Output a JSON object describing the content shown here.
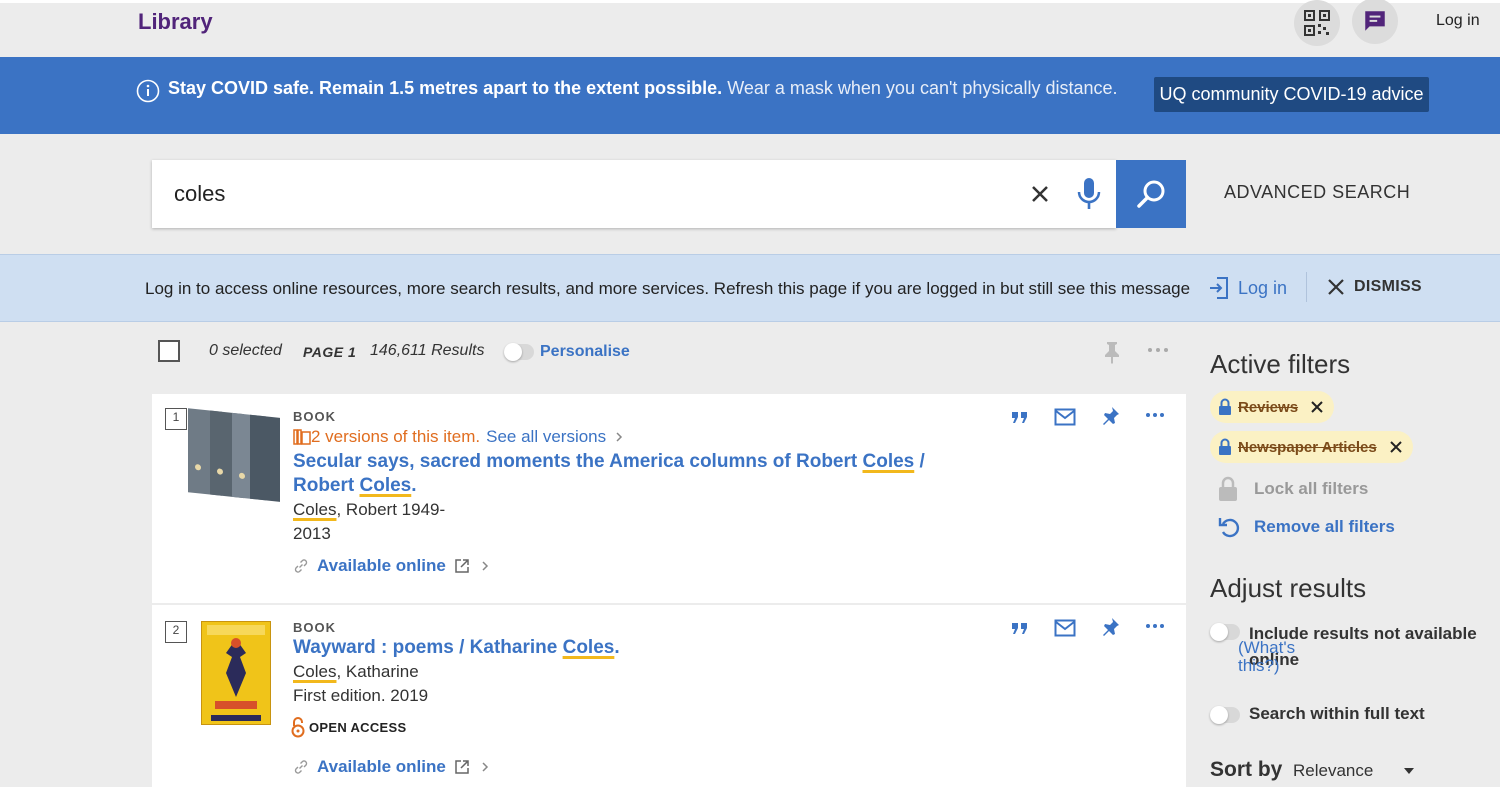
{
  "header": {
    "logo": "Library",
    "login": "Log in"
  },
  "covid_banner": {
    "bold_text": "Stay COVID safe. Remain 1.5 metres apart to the extent possible.",
    "light_text": "Wear a mask when you can't physically distance.",
    "advice_button": "UQ community COVID-19 advice"
  },
  "search": {
    "query": "coles",
    "advanced_label": "ADVANCED SEARCH"
  },
  "login_notice": {
    "message": "Log in to access online resources, more search results, and more services. Refresh this page if you are logged in but still see this message",
    "login_label": "Log in",
    "dismiss_label": "DISMISS"
  },
  "toolbar": {
    "selected": "0 selected",
    "page": "PAGE 1",
    "results": "146,611 Results",
    "personalise": "Personalise"
  },
  "results": [
    {
      "number": "1",
      "type": "BOOK",
      "versions_text": "2 versions of this item.",
      "see_all": "See all versions",
      "title_part1": "Secular says, sacred moments the America columns of Robert ",
      "title_hl1": "Coles",
      "title_part2": " / Robert ",
      "title_hl2": "Coles",
      "title_part3": ".",
      "author_hl": "Coles",
      "author_rest": ", Robert 1949-",
      "date": "2013",
      "availability": "Available online"
    },
    {
      "number": "2",
      "type": "BOOK",
      "title_part1": "Wayward : poems / Katharine ",
      "title_hl1": "Coles",
      "title_part2": ".",
      "author_hl": "Coles",
      "author_rest": ", Katharine",
      "edition": "First edition. 2019",
      "open_access": "OPEN ACCESS",
      "availability": "Available online"
    }
  ],
  "sidebar": {
    "active_filters_title": "Active filters",
    "filters": [
      "Reviews",
      "Newspaper Articles"
    ],
    "lock_all": "Lock all filters",
    "remove_all": "Remove all filters",
    "adjust_title": "Adjust results",
    "include_not_available": "Include results not available online",
    "whats_this": "(What's this?)",
    "search_fulltext": "Search within full text",
    "sort_by_label": "Sort by",
    "sort_by_value": "Relevance"
  },
  "colors": {
    "primary": "#3b73c4",
    "advice_bg": "#1f4a82",
    "highlight": "#f2b81c",
    "versions": "#e06d1f",
    "brand": "#51247a"
  }
}
